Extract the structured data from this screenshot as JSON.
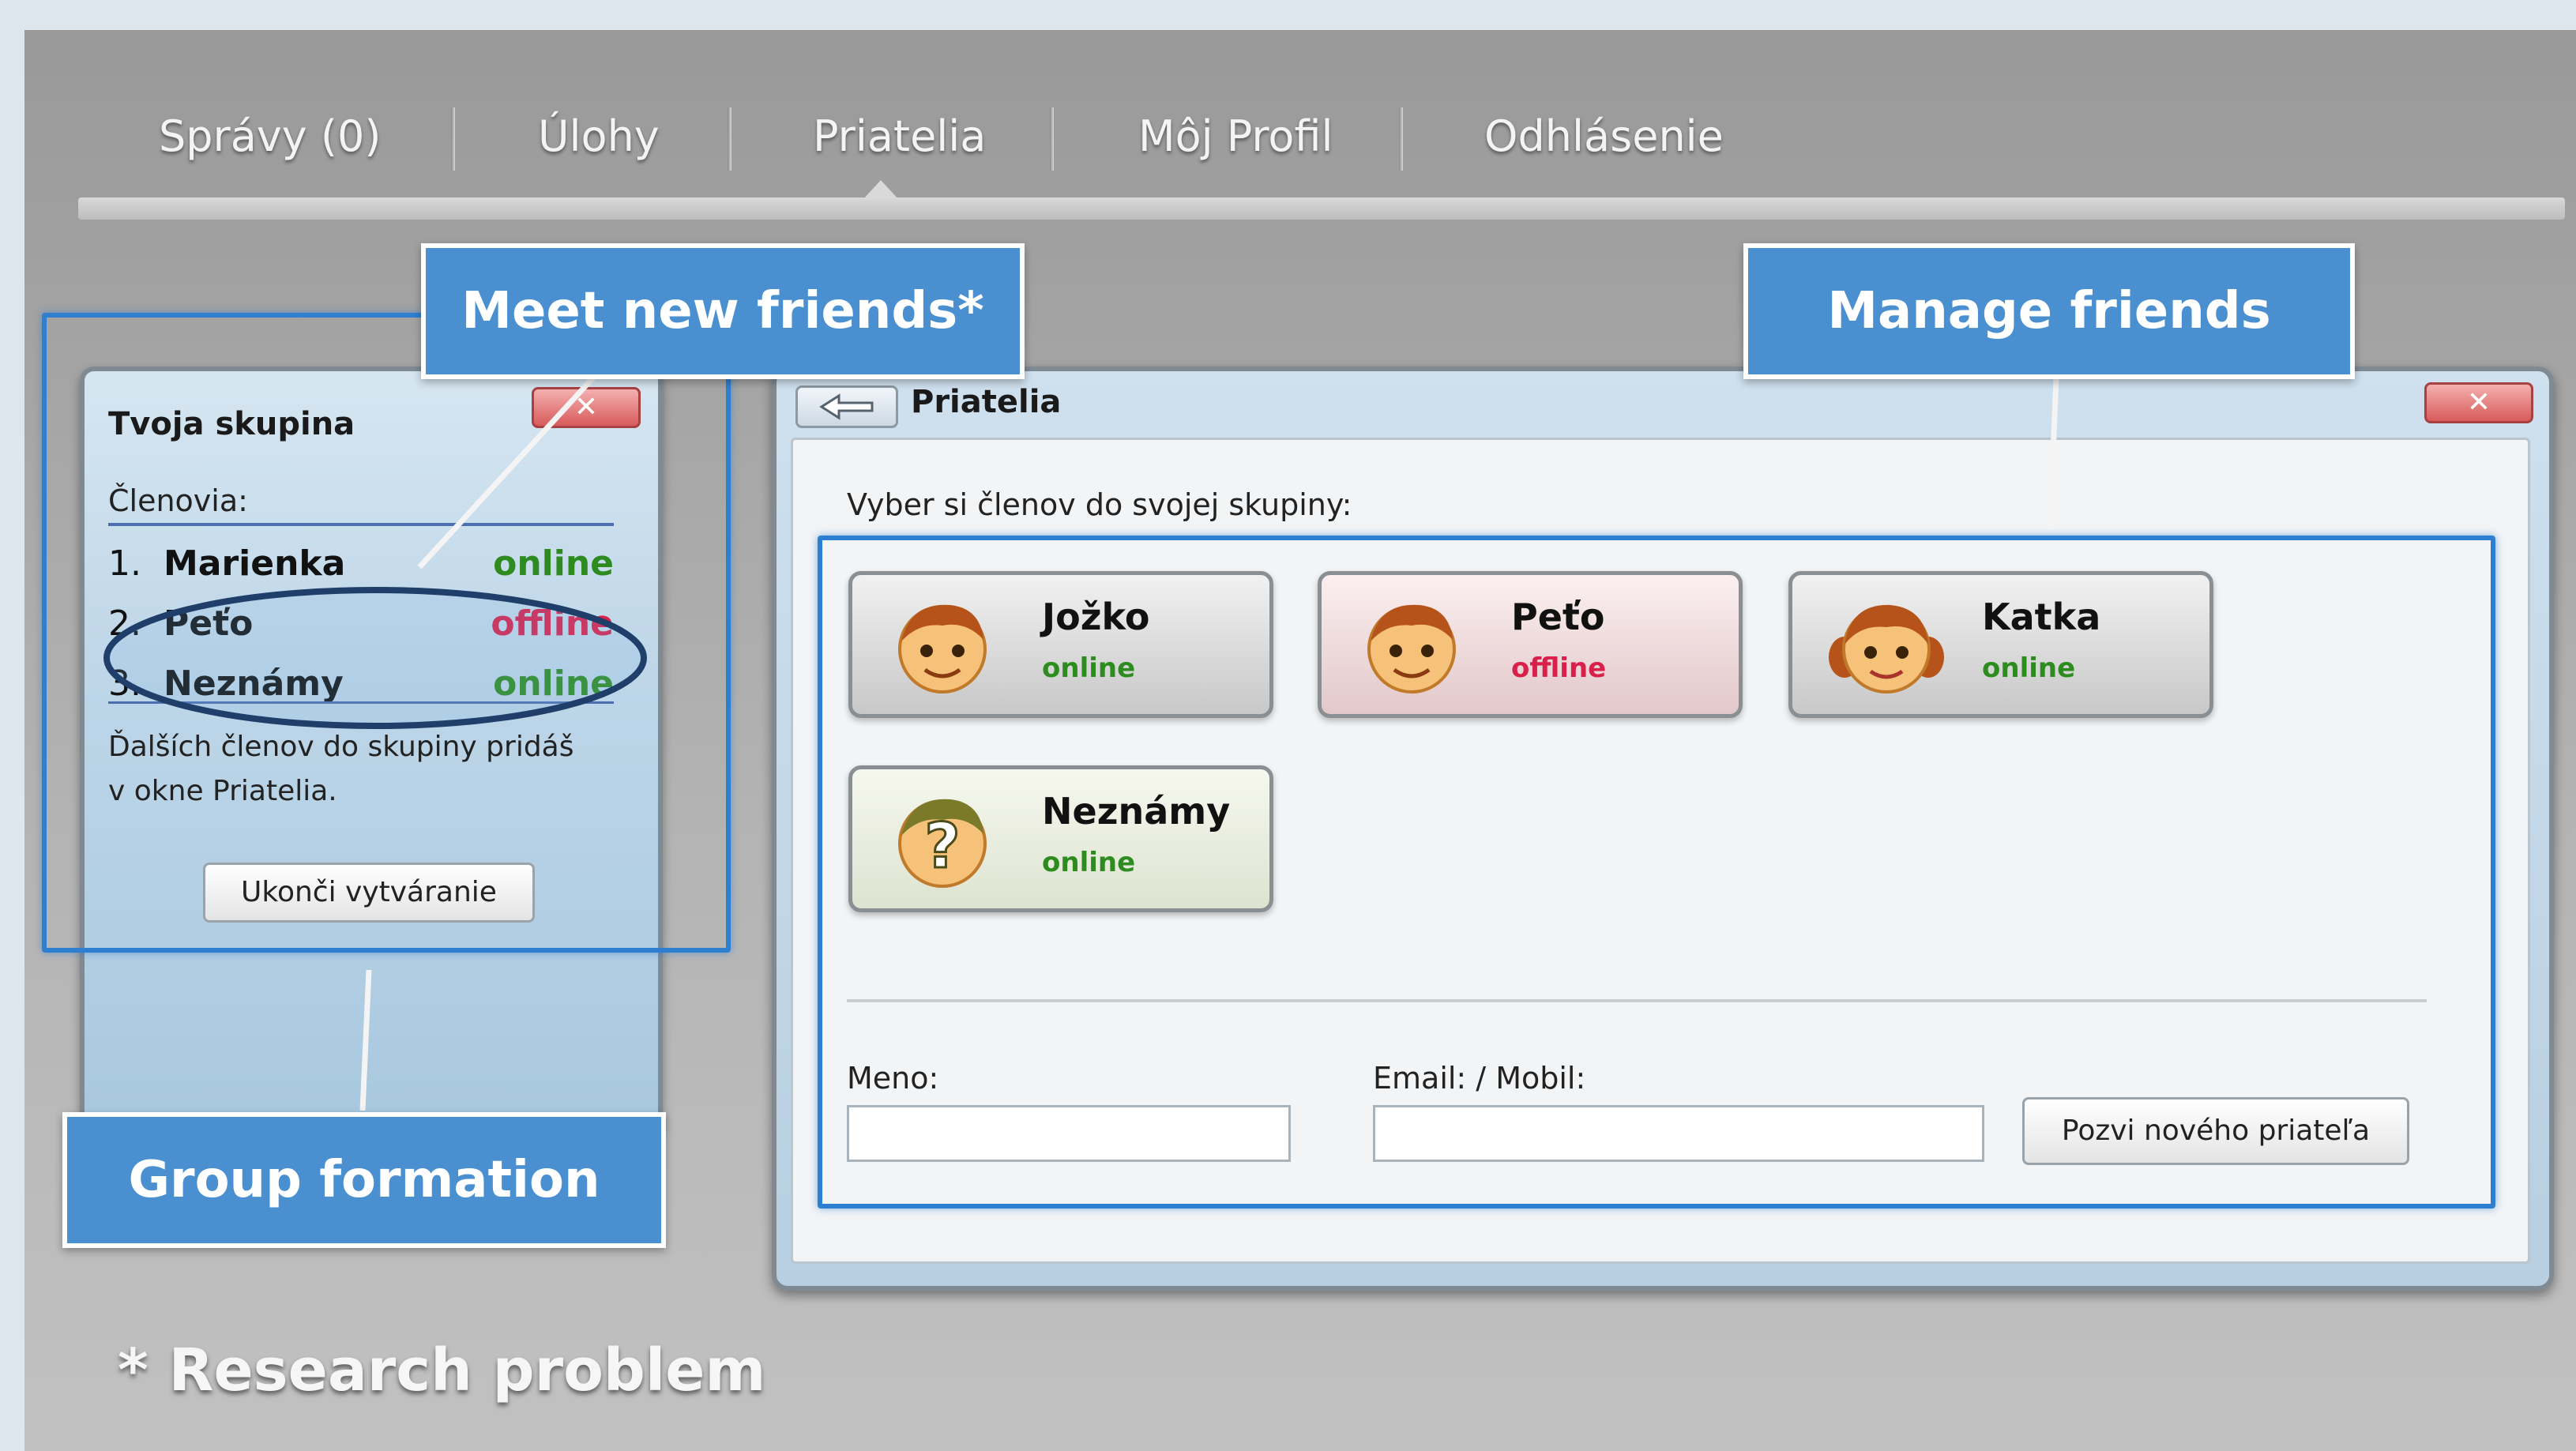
{
  "nav": {
    "items": [
      "Správy (0)",
      "Úlohy",
      "Priatelia",
      "Môj Profil",
      "Odhlásenie"
    ],
    "active": "Priatelia"
  },
  "group_panel": {
    "title": "Tvoja skupina",
    "close_icon": "close-x-icon",
    "members_label": "Členovia:",
    "members": [
      {
        "num": "1.",
        "name": "Marienka",
        "status": "online"
      },
      {
        "num": "2.",
        "name": "Peťo",
        "status": "offline"
      },
      {
        "num": "3.",
        "name": "Neznámy",
        "status": "online"
      }
    ],
    "hint_line1": "Ďalších členov do skupiny pridáš",
    "hint_line2": "v okne Priatelia.",
    "finish_button": "Ukonči vytváranie"
  },
  "friends_window": {
    "title": "Priatelia",
    "back_icon": "arrow-left-icon",
    "close_icon": "close-x-icon",
    "select_label": "Vyber si členov do svojej skupiny:",
    "friends": [
      {
        "name": "Jožko",
        "status": "online",
        "avatar": "boy-face-icon"
      },
      {
        "name": "Peťo",
        "status": "offline",
        "avatar": "boy-face-icon"
      },
      {
        "name": "Katka",
        "status": "online",
        "avatar": "girl-face-icon"
      },
      {
        "name": "Neznámy",
        "status": "online",
        "avatar": "unknown-face-icon"
      }
    ],
    "name_label": "Meno:",
    "email_label": "Email: / Mobil:",
    "name_value": "",
    "email_value": "",
    "invite_button": "Pozvi nového priateľa"
  },
  "callouts": {
    "meet": "Meet new friends*",
    "manage": "Manage friends",
    "group": "Group formation"
  },
  "footnote": "* Research problem",
  "colors": {
    "online": "#2e8b1f",
    "offline": "#d8204a",
    "callout": "#4a90d0",
    "highlight": "#2f7fd0"
  }
}
